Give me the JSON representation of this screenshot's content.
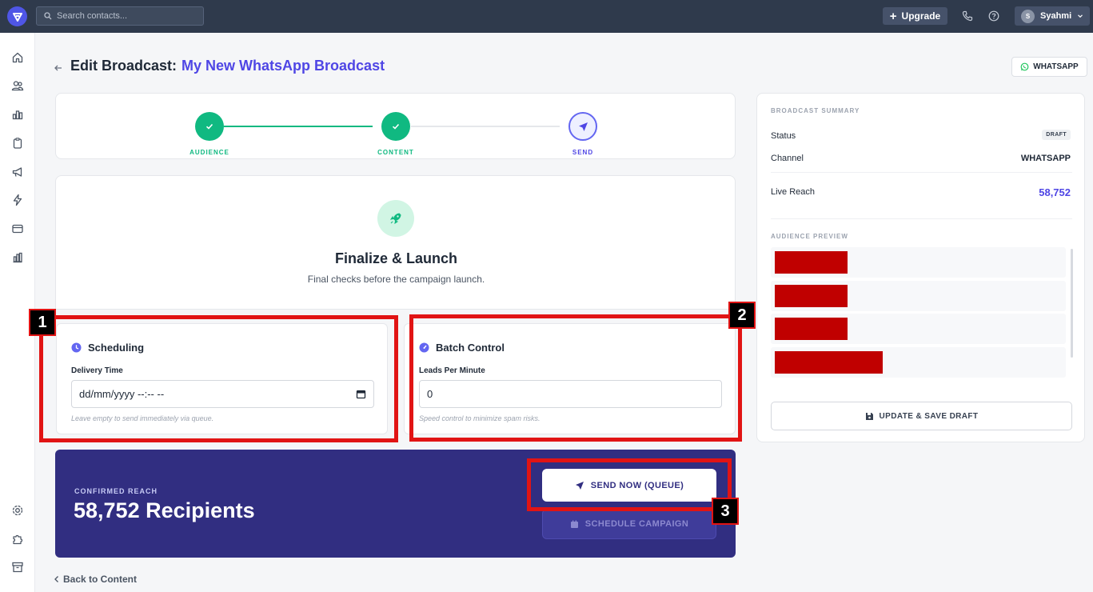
{
  "topbar": {
    "search_placeholder": "Search contacts...",
    "upgrade_label": "Upgrade",
    "user_initial": "S",
    "user_name": "Syahmi"
  },
  "header": {
    "title_prefix": "Edit Broadcast:",
    "broadcast_name": "My New WhatsApp Broadcast",
    "channel_badge": "WHATSAPP"
  },
  "stepper": {
    "steps": [
      {
        "label": "AUDIENCE",
        "state": "done"
      },
      {
        "label": "CONTENT",
        "state": "done"
      },
      {
        "label": "SEND",
        "state": "current"
      }
    ]
  },
  "launch": {
    "title": "Finalize & Launch",
    "subtitle": "Final checks before the campaign launch."
  },
  "scheduling": {
    "title": "Scheduling",
    "field_label": "Delivery Time",
    "field_value": "dd/mm/yyyy --:-- --",
    "hint": "Leave empty to send immediately via queue."
  },
  "batch": {
    "title": "Batch Control",
    "field_label": "Leads Per Minute",
    "field_value": "0",
    "hint": "Speed control to minimize spam risks."
  },
  "markers": [
    "1",
    "2",
    "3"
  ],
  "reach": {
    "label": "CONFIRMED REACH",
    "value": "58,752 Recipients",
    "send_label": "SEND NOW (QUEUE)",
    "schedule_label": "SCHEDULE CAMPAIGN"
  },
  "back_link": "Back to Content",
  "summary": {
    "heading": "BROADCAST SUMMARY",
    "status_label": "Status",
    "status_value": "DRAFT",
    "channel_label": "Channel",
    "channel_value": "WHATSAPP",
    "reach_label": "Live Reach",
    "reach_value": "58,752",
    "preview_heading": "AUDIENCE PREVIEW",
    "save_label": "UPDATE & SAVE DRAFT"
  },
  "colors": {
    "accent": "#4f46e5",
    "success": "#10b981",
    "banner": "#312e81",
    "highlight": "#e11414",
    "redacted": "#c00000"
  },
  "icons": {
    "sidebar": [
      "home-icon",
      "contacts-icon",
      "chart-icon",
      "clipboard-icon",
      "megaphone-icon",
      "bolt-icon",
      "card-icon",
      "analytics-icon",
      "settings-icon",
      "puzzle-icon",
      "archive-icon"
    ]
  }
}
